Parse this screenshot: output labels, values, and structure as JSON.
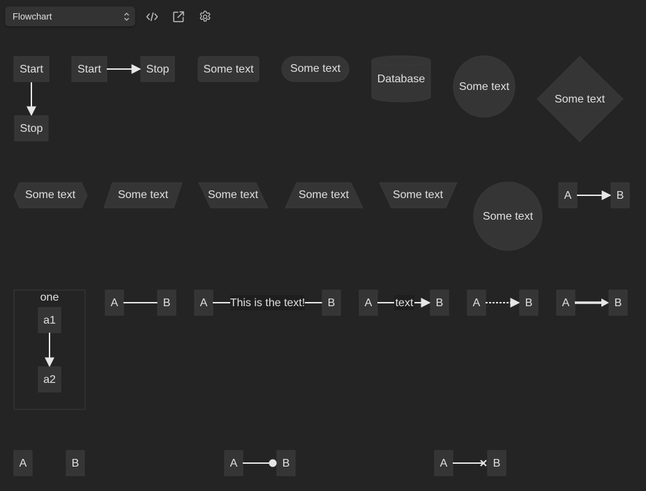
{
  "toolbar": {
    "diagram_type": "Flowchart",
    "icons": [
      "code-icon",
      "external-link-icon",
      "settings-gear-icon"
    ]
  },
  "colors": {
    "background": "#242424",
    "node_fill": "#353535",
    "node_stroke": "#3a3a3a",
    "edge": "#e6e6e6",
    "text": "#e0e0e0",
    "subgraph_fill": "#242424",
    "subgraph_stroke": "#3a3a3a",
    "edge_label_bg": "#1e1e1e"
  },
  "diagrams": {
    "vertical": {
      "from": "Start",
      "to": "Stop"
    },
    "horizontal": {
      "from": "Start",
      "to": "Stop"
    },
    "round_rect": "Some text",
    "stadium": "Some text",
    "database": "Database",
    "circle": "Some text",
    "rhombus": "Some text",
    "hexagon": "Some text",
    "parallelogram": "Some text",
    "parallelogram_alt": "Some text",
    "trapezoid": "Some text",
    "trapezoid_alt": "Some text",
    "double_circle": "Some text",
    "arrow_ab": {
      "from": "A",
      "to": "B"
    },
    "subgraph": {
      "title": "one",
      "from": "a1",
      "to": "a2"
    },
    "open_link": {
      "from": "A",
      "to": "B"
    },
    "text_link": {
      "from": "A",
      "to": "B",
      "label": "This is the text!"
    },
    "text_arrow": {
      "from": "A",
      "to": "B",
      "label": "text"
    },
    "dotted": {
      "from": "A",
      "to": "B"
    },
    "thick": {
      "from": "A",
      "to": "B"
    },
    "invisible": {
      "from": "A",
      "to": "B"
    },
    "circle_edge": {
      "from": "A",
      "to": "B"
    },
    "cross_edge": {
      "from": "A",
      "to": "B"
    }
  }
}
